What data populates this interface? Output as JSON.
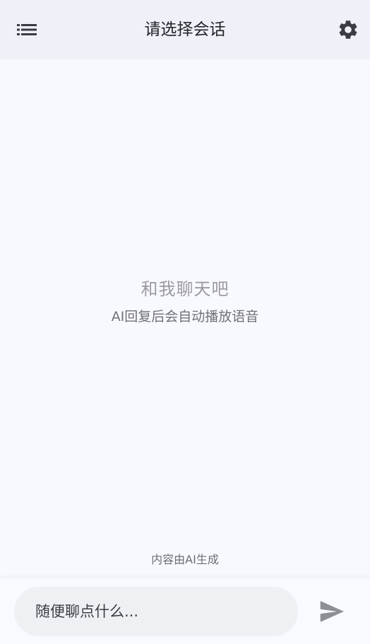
{
  "header": {
    "title": "请选择会话",
    "menu_icon": "list-menu-icon",
    "settings_icon": "gear-icon"
  },
  "empty_state": {
    "title": "和我聊天吧",
    "subtitle": "AI回复后会自动播放语音"
  },
  "footer_note": "内容由AI生成",
  "composer": {
    "placeholder": "随便聊点什么...",
    "send_icon": "send-icon"
  },
  "colors": {
    "header_bg": "#eef1f8",
    "page_bg": "#f8f9fe",
    "icon": "#3b3c42",
    "send_icon": "#8e8f95",
    "input_bg": "#eef0f4"
  }
}
